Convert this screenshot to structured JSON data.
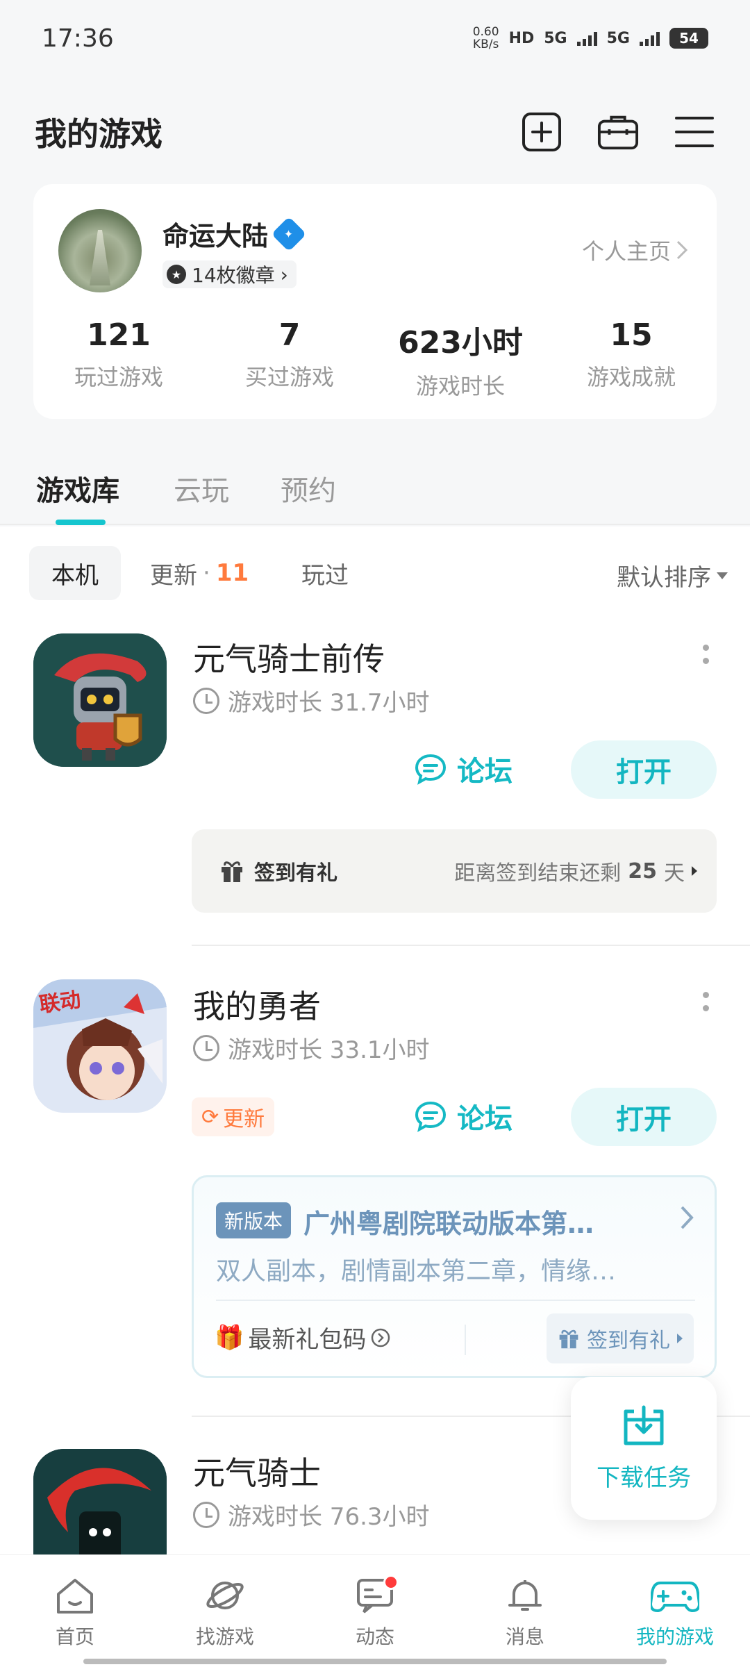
{
  "status_bar": {
    "time": "17:36",
    "net_speed_value": "0.60",
    "net_speed_unit": "KB/s",
    "hd_label": "HD",
    "signal_1": "5G",
    "signal_2": "5G",
    "battery": "54"
  },
  "header": {
    "title": "我的游戏",
    "icons": [
      "add-square-icon",
      "toolbox-icon",
      "menu-icon"
    ]
  },
  "profile": {
    "name": "命运大陆",
    "badges": "14枚徽章",
    "profile_link": "个人主页",
    "stats": [
      {
        "value": "121",
        "label": "玩过游戏"
      },
      {
        "value": "7",
        "label": "买过游戏"
      },
      {
        "value": "623小时",
        "label": "游戏时长"
      },
      {
        "value": "15",
        "label": "游戏成就"
      }
    ]
  },
  "tabs": [
    {
      "label": "游戏库",
      "active": true
    },
    {
      "label": "云玩",
      "active": false
    },
    {
      "label": "预约",
      "active": false
    }
  ],
  "filters": {
    "local": "本机",
    "update_label": "更新",
    "update_sep": "·",
    "update_count": "11",
    "played": "玩过",
    "sort": "默认排序"
  },
  "games": [
    {
      "title": "元气骑士前传",
      "playtime": "游戏时长 31.7小时",
      "forum": "论坛",
      "open": "打开",
      "signin_left": "签到有礼",
      "signin_right_prefix": "距离签到结束还剩",
      "signin_days": "25",
      "signin_unit": "天"
    },
    {
      "title": "我的勇者",
      "icon_label": "联动",
      "playtime": "游戏时长 33.1小时",
      "update_tag": "更新",
      "forum": "论坛",
      "open": "打开",
      "news_badge": "新版本",
      "news_title": "广州粤剧院联动版本第…",
      "news_desc": "双人副本，剧情副本第二章，情缘…",
      "gift_code": "最新礼包码",
      "signin": "签到有礼"
    },
    {
      "title": "元气骑士",
      "playtime": "游戏时长 76.3小时"
    }
  ],
  "fab": {
    "label": "下载任务"
  },
  "bottom_nav": [
    {
      "label": "首页",
      "icon": "home-icon"
    },
    {
      "label": "找游戏",
      "icon": "planet-icon"
    },
    {
      "label": "动态",
      "icon": "chat-icon"
    },
    {
      "label": "消息",
      "icon": "bell-icon"
    },
    {
      "label": "我的游戏",
      "icon": "gamepad-icon",
      "active": true
    }
  ],
  "colors": {
    "accent": "#13b6c1",
    "update_orange": "#ff7a3d",
    "news_blue": "#6c94ba"
  }
}
